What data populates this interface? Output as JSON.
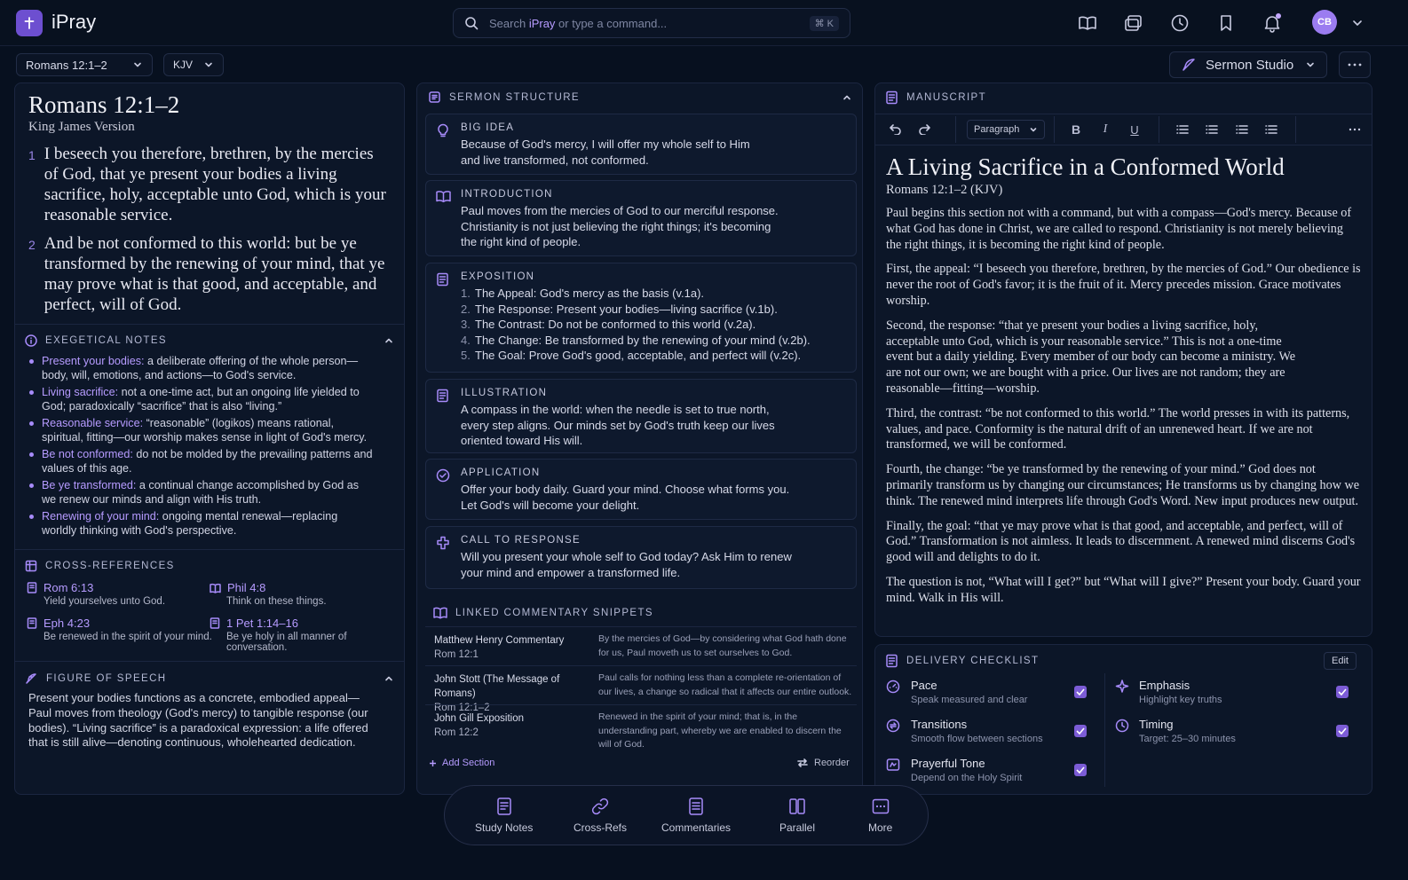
{
  "app": {
    "name": "iPray",
    "avatar_initials": "CB"
  },
  "search": {
    "prefix": "Search ",
    "brand": "iPray",
    "suffix": " or type a command...",
    "shortcut": "⌘ K"
  },
  "toolbar": {
    "passage": "Romans 12:1–2",
    "version": "KJV",
    "mode": "Sermon Studio"
  },
  "scripture": {
    "title": "Romans 12:1–2",
    "version_name": "King James Version",
    "verses": [
      {
        "num": "1",
        "text": "I beseech you therefore, brethren, by the mercies of God, that ye present your bodies a living sacrifice, holy, acceptable unto God, which is your reasonable service."
      },
      {
        "num": "2",
        "text": "And be not conformed to this world: but be ye transformed by the renewing of your mind, that ye may prove what is that good, and acceptable, and perfect, will of God."
      }
    ]
  },
  "exegetical": {
    "title": "Exegetical Notes",
    "notes": [
      {
        "term": "Present your bodies:",
        "text": " a deliberate offering of the whole person—body, will, emotions, and actions—to God's service."
      },
      {
        "term": "Living sacrifice:",
        "text": " not a one-time act, but an ongoing life yielded to God; paradoxically “sacrifice” that is also “living.”"
      },
      {
        "term": "Reasonable service:",
        "text": " “reasonable” (logikos) means rational, spiritual, fitting—our worship makes sense in light of God's mercy."
      },
      {
        "term": "Be not conformed:",
        "text": " do not be molded by the prevailing patterns and values of this age."
      },
      {
        "term": "Be ye transformed:",
        "text": " a continual change accomplished by God as we renew our minds and align with His truth."
      },
      {
        "term": "Renewing of your mind:",
        "text": " ongoing mental renewal—replacing worldly thinking with God's perspective."
      }
    ]
  },
  "crossrefs": {
    "title": "Cross-References",
    "items": [
      {
        "ref": "Rom 6:13",
        "text": "Yield yourselves unto God."
      },
      {
        "ref": "Phil 4:8",
        "text": "Think on these things."
      },
      {
        "ref": "Eph 4:23",
        "text": "Be renewed in the spirit of your mind."
      },
      {
        "ref": "1 Pet 1:14–16",
        "text": "Be ye holy in all manner of conversation."
      }
    ]
  },
  "figure": {
    "title": "Figure of Speech",
    "text": "Present your bodies functions as a concrete, embodied appeal—Paul moves from theology (God's mercy) to tangible response (our bodies). “Living sacrifice” is a paradoxical expression: a life offered that is still alive—denoting continuous, wholehearted dedication."
  },
  "structure": {
    "title": "Sermon Structure",
    "big_idea": {
      "title": "Big Idea",
      "text": "Because of God's mercy, I will offer my whole self to Him and live transformed, not conformed."
    },
    "introduction": {
      "title": "Introduction",
      "text": "Paul moves from the mercies of God to our merciful response. Christianity is not just believing the right things; it's becoming the right kind of people."
    },
    "exposition": {
      "title": "Exposition",
      "items": [
        {
          "n": "1.",
          "text": "The Appeal: God's mercy as the basis (v.1a)."
        },
        {
          "n": "2.",
          "text": "The Response: Present your bodies—living sacrifice (v.1b)."
        },
        {
          "n": "3.",
          "text": "The Contrast: Do not be conformed to this world (v.2a)."
        },
        {
          "n": "4.",
          "text": "The Change: Be transformed by the renewing of your mind (v.2b)."
        },
        {
          "n": "5.",
          "text": "The Goal: Prove God's good, acceptable, and perfect will (v.2c)."
        }
      ]
    },
    "illustration": {
      "title": "Illustration",
      "text": "A compass in the world: when the needle is set to true north, every step aligns. Our minds set by God's truth keep our lives oriented toward His will."
    },
    "application": {
      "title": "Application",
      "text": "Offer your body daily. Guard your mind. Choose what forms you. Let God's will become your delight."
    },
    "call": {
      "title": "Call to Response",
      "text": "Will you present your whole self to God today? Ask Him to renew your mind and empower a transformed life."
    },
    "commentary": {
      "title": "Linked Commentary Snippets",
      "items": [
        {
          "source": "Matthew Henry Commentary",
          "ref": "Rom 12:1",
          "text": "By the mercies of God—by considering what God hath done for us, Paul moveth us to set ourselves to God."
        },
        {
          "source": "John Stott (The Message of Romans)",
          "ref": "Rom 12:1–2",
          "text": "Paul calls for nothing less than a complete re-orientation of our lives, a change so radical that it affects our entire outlook."
        },
        {
          "source": "John Gill Exposition",
          "ref": "Rom 12:2",
          "text": "Renewed in the spirit of your mind; that is, in the understanding part, whereby we are enabled to discern the will of God."
        }
      ]
    },
    "add_section": "Add Section",
    "reorder": "Reorder"
  },
  "manuscript": {
    "title": "Manuscript",
    "style_select": "Paragraph",
    "heading": "A Living Sacrifice in a Conformed World",
    "subheading": "Romans 12:1–2 (KJV)",
    "paragraphs": [
      "Paul begins this section not with a command, but with a compass—God's mercy. Because of what God has done in Christ, we are called to respond. Christianity is not merely believing the right things, it is becoming the right kind of people.",
      "First, the appeal: “I beseech you therefore, brethren, by the mercies of God.” Our obedience is never the root of God's favor; it is the fruit of it. Mercy precedes mission. Grace motivates worship.",
      "Second, the response: “that ye present your bodies a living sacrifice, holy, acceptable unto God, which is your reasonable service.” This is not a one-time event but a daily yielding. Every member of our body can become a ministry. We are not our own; we are bought with a price. Our lives are not random; they are reasonable—fitting—worship.",
      "Third, the contrast: “be not conformed to this world.” The world presses in with its patterns, values, and pace. Conformity is the natural drift of an unrenewed heart. If we are not transformed, we will be conformed.",
      "Fourth, the change: “be ye transformed by the renewing of your mind.” God does not primarily transform us by changing our circumstances; He transforms us by changing how we think. The renewed mind interprets life through God's Word. New input produces new output.",
      "Finally, the goal: “that ye may prove what is that good, and acceptable, and perfect, will of God.” Transformation is not aimless. It leads to discernment. A renewed mind discerns God's good will and delights to do it.",
      "The question is not, “What will I get?” but “What will I give?” Present your body. Guard your mind. Walk in His will."
    ]
  },
  "checklist": {
    "title": "Delivery Checklist",
    "edit": "Edit",
    "items": [
      {
        "title": "Pace",
        "sub": "Speak measured and clear",
        "checked": true
      },
      {
        "title": "Emphasis",
        "sub": "Highlight key truths",
        "checked": true
      },
      {
        "title": "Transitions",
        "sub": "Smooth flow between sections",
        "checked": true
      },
      {
        "title": "Timing",
        "sub": "Target: 25–30 minutes",
        "checked": true
      },
      {
        "title": "Prayerful Tone",
        "sub": "Depend on the Holy Spirit",
        "checked": true
      }
    ]
  },
  "dock": {
    "items": [
      {
        "label": "Study Notes",
        "icon": "study-notes-icon"
      },
      {
        "label": "Cross-Refs",
        "icon": "link-icon"
      },
      {
        "label": "Commentaries",
        "icon": "document-icon"
      },
      {
        "label": "Parallel",
        "icon": "columns-icon"
      },
      {
        "label": "More",
        "icon": "more-icon"
      }
    ]
  },
  "colors": {
    "accent": "#a78bfa",
    "background": "#07101f",
    "panel": "#0c1628"
  }
}
